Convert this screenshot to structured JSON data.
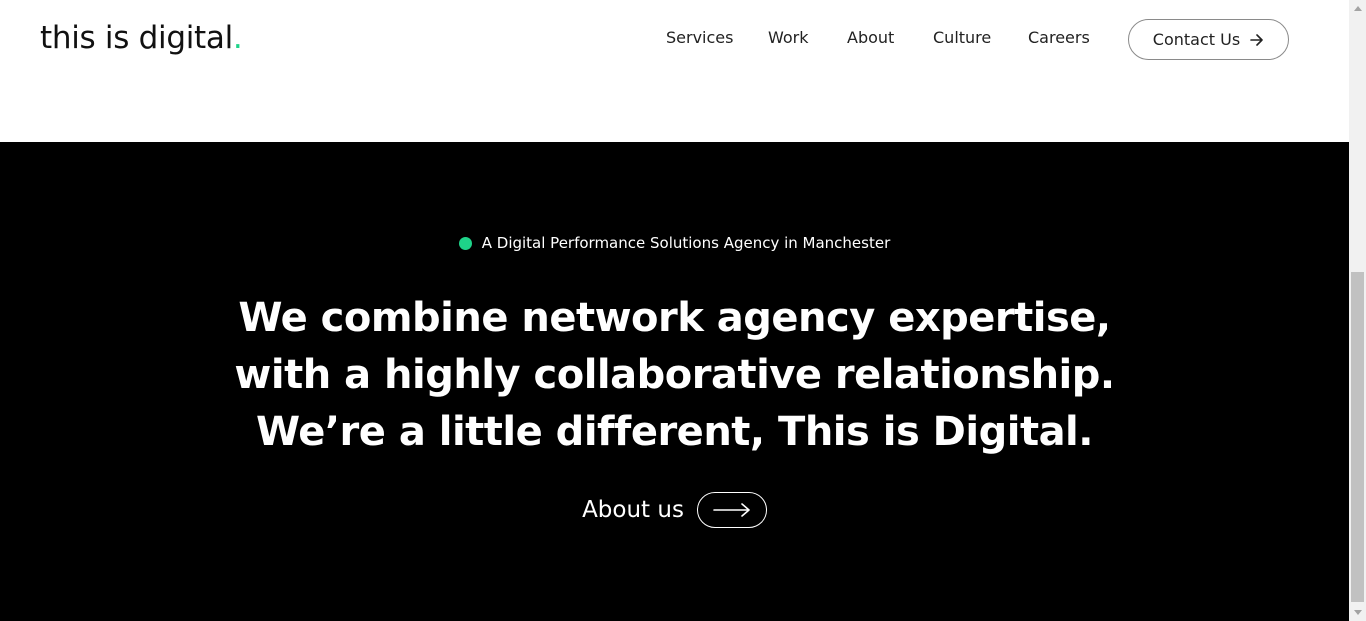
{
  "header": {
    "logo_text": "this is digital",
    "logo_dot": ".",
    "nav": {
      "services": "Services",
      "work": "Work",
      "about": "About",
      "culture": "Culture",
      "careers": "Careers"
    },
    "contact_label": "Contact Us"
  },
  "hero": {
    "tagline": "A Digital Performance Solutions Agency in Manchester",
    "headline": {
      "line1": "We combine network agency expertise,",
      "line2": "with a highly collaborative relationship.",
      "line3": "We’re a little different, This is Digital."
    },
    "cta_label": "About us"
  },
  "colors": {
    "accent": "#1ed389",
    "hero_bg": "#000000",
    "header_bg": "#ffffff"
  },
  "icons": {
    "contact_arrow": "arrow-right-icon",
    "about_arrow": "long-arrow-right-icon"
  }
}
